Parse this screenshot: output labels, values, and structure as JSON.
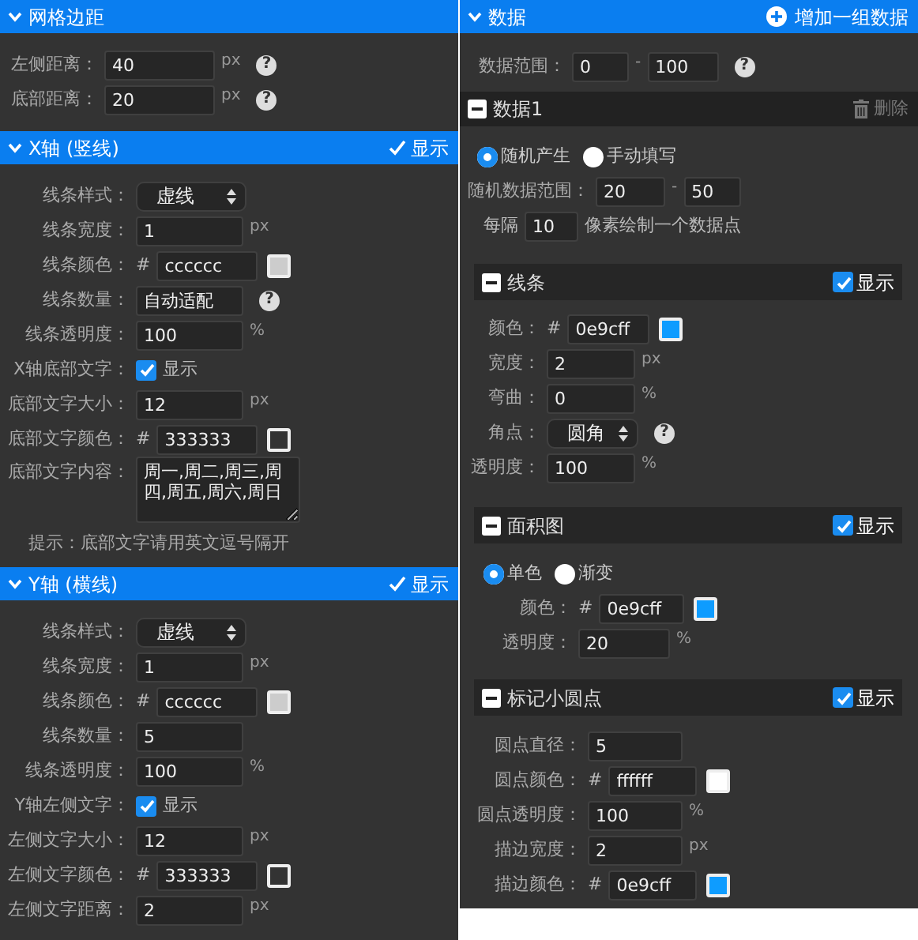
{
  "left": {
    "sections": [
      {
        "title": "网格边距",
        "expanded": true,
        "rows": [
          {
            "kind": "input",
            "label": "左侧距离：",
            "value": "40",
            "unit": "px",
            "help": "?"
          },
          {
            "kind": "input",
            "label": "底部距离：",
            "value": "20",
            "unit": "px",
            "help": "?"
          }
        ]
      },
      {
        "title": "X轴 (竖线)",
        "expanded": true,
        "show": {
          "label": "显示",
          "checked": true
        },
        "rows": [
          {
            "kind": "select",
            "label": "线条样式：",
            "value": "虚线"
          },
          {
            "kind": "input",
            "label": "线条宽度：",
            "value": "1",
            "unit": "px"
          },
          {
            "kind": "color",
            "label": "线条颜色：",
            "prefix": "#",
            "value": "cccccc",
            "color": "#cccccc"
          },
          {
            "kind": "input",
            "label": "线条数量：",
            "value": "自动适配",
            "help": "?"
          },
          {
            "kind": "input",
            "label": "线条透明度：",
            "value": "100",
            "unit": "%"
          },
          {
            "kind": "checkbox",
            "label": "X轴底部文字：",
            "text": "显示",
            "checked": true
          },
          {
            "kind": "input",
            "label": "底部文字大小：",
            "value": "12",
            "unit": "px"
          },
          {
            "kind": "color",
            "label": "底部文字颜色：",
            "prefix": "#",
            "value": "333333",
            "color": "#333333"
          },
          {
            "kind": "textarea",
            "label": "底部文字内容：",
            "value": "周一,周二,周三,周四,周五,周六,周日"
          },
          {
            "kind": "note",
            "text": "提示：底部文字请用英文逗号隔开"
          }
        ]
      },
      {
        "title": "Y轴 (横线)",
        "expanded": true,
        "show": {
          "label": "显示",
          "checked": true
        },
        "rows": [
          {
            "kind": "select",
            "label": "线条样式：",
            "value": "虚线"
          },
          {
            "kind": "input",
            "label": "线条宽度：",
            "value": "1",
            "unit": "px"
          },
          {
            "kind": "color",
            "label": "线条颜色：",
            "prefix": "#",
            "value": "cccccc",
            "color": "#cccccc"
          },
          {
            "kind": "input",
            "label": "线条数量：",
            "value": "5"
          },
          {
            "kind": "input",
            "label": "线条透明度：",
            "value": "100",
            "unit": "%"
          },
          {
            "kind": "checkbox",
            "label": "Y轴左侧文字：",
            "text": "显示",
            "checked": true
          },
          {
            "kind": "input",
            "label": "左侧文字大小：",
            "value": "12",
            "unit": "px"
          },
          {
            "kind": "color",
            "label": "左侧文字颜色：",
            "prefix": "#",
            "value": "333333",
            "color": "#333333"
          },
          {
            "kind": "input",
            "label": "左侧文字距离：",
            "value": "2",
            "unit": "px"
          }
        ]
      }
    ]
  },
  "right": {
    "title": "数据",
    "expanded": true,
    "add_button": "增加一组数据",
    "rows": [
      {
        "kind": "range",
        "label": "数据范围：",
        "from": "0",
        "separator": "-",
        "to": "100",
        "help": "?"
      }
    ],
    "datasets": [
      {
        "title": "数据1",
        "expanded": true,
        "delete_button": "删除",
        "rows": [
          {
            "kind": "radio",
            "options": [
              {
                "label": "随机产生",
                "selected": true
              },
              {
                "label": "手动填写",
                "selected": false
              }
            ]
          },
          {
            "kind": "range",
            "label": "随机数据范围：",
            "from": "20",
            "separator": "-",
            "to": "50"
          },
          {
            "kind": "interval",
            "prefix": "每隔",
            "value": "10",
            "suffix": "像素绘制一个数据点"
          }
        ],
        "groups": [
          {
            "title": "线条",
            "expanded": true,
            "show": {
              "label": "显示",
              "checked": true
            },
            "rows": [
              {
                "kind": "color",
                "label": "颜色：",
                "prefix": "#",
                "value": "0e9cff",
                "color": "#0e9cff"
              },
              {
                "kind": "input",
                "label": "宽度：",
                "value": "2",
                "unit": "px"
              },
              {
                "kind": "input",
                "label": "弯曲：",
                "value": "0",
                "unit": "%"
              },
              {
                "kind": "select",
                "label": "角点：",
                "value": "圆角",
                "help": "?"
              },
              {
                "kind": "input",
                "label": "透明度：",
                "value": "100",
                "unit": "%"
              }
            ]
          },
          {
            "title": "面积图",
            "expanded": true,
            "show": {
              "label": "显示",
              "checked": true
            },
            "rows": [
              {
                "kind": "radio",
                "options": [
                  {
                    "label": "单色",
                    "selected": true
                  },
                  {
                    "label": "渐变",
                    "selected": false
                  }
                ]
              },
              {
                "kind": "color",
                "label": "颜色：",
                "prefix": "#",
                "value": "0e9cff",
                "color": "#0e9cff"
              },
              {
                "kind": "input",
                "label": "透明度：",
                "value": "20",
                "unit": "%"
              }
            ]
          },
          {
            "title": "标记小圆点",
            "expanded": true,
            "show": {
              "label": "显示",
              "checked": true
            },
            "rows": [
              {
                "kind": "input",
                "label": "圆点直径：",
                "value": "5"
              },
              {
                "kind": "color",
                "label": "圆点颜色：",
                "prefix": "#",
                "value": "ffffff",
                "color": "#ffffff"
              },
              {
                "kind": "input",
                "label": "圆点透明度：",
                "value": "100",
                "unit": "%"
              },
              {
                "kind": "input",
                "label": "描边宽度：",
                "value": "2",
                "unit": "px"
              },
              {
                "kind": "color",
                "label": "描边颜色：",
                "prefix": "#",
                "value": "0e9cff",
                "color": "#0e9cff"
              }
            ]
          }
        ]
      }
    ]
  }
}
